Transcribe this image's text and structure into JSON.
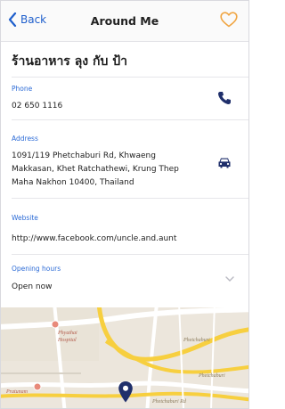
{
  "nav": {
    "back_label": "Back",
    "title": "Around Me"
  },
  "place": {
    "name": "ร้านอาหาร ลุง กับ ป้า"
  },
  "phone": {
    "label": "Phone",
    "value": "02 650 1116"
  },
  "address": {
    "label": "Address",
    "line1": "1091/119 Phetchaburi Rd, Khwaeng",
    "line2": "Makkasan, Khet Ratchathewi, Krung Thep",
    "line3": "Maha Nakhon 10400, Thailand"
  },
  "website": {
    "label": "Website",
    "value": "http://www.facebook.com/uncle.and.aunt"
  },
  "hours": {
    "label": "Opening hours",
    "value": "Open now"
  },
  "map": {
    "road_east": "Phetchaburi",
    "road_east_2": "Phetchaburi",
    "poi_1": "Phyathai",
    "poi_2": "Hospital",
    "poi_3": "Pratunam",
    "road_south": "Phetchaburi Rd"
  },
  "colors": {
    "accent_blue": "#1f5fcc",
    "favorite_orange": "#f0a542",
    "pin_navy": "#1f2f6b"
  }
}
